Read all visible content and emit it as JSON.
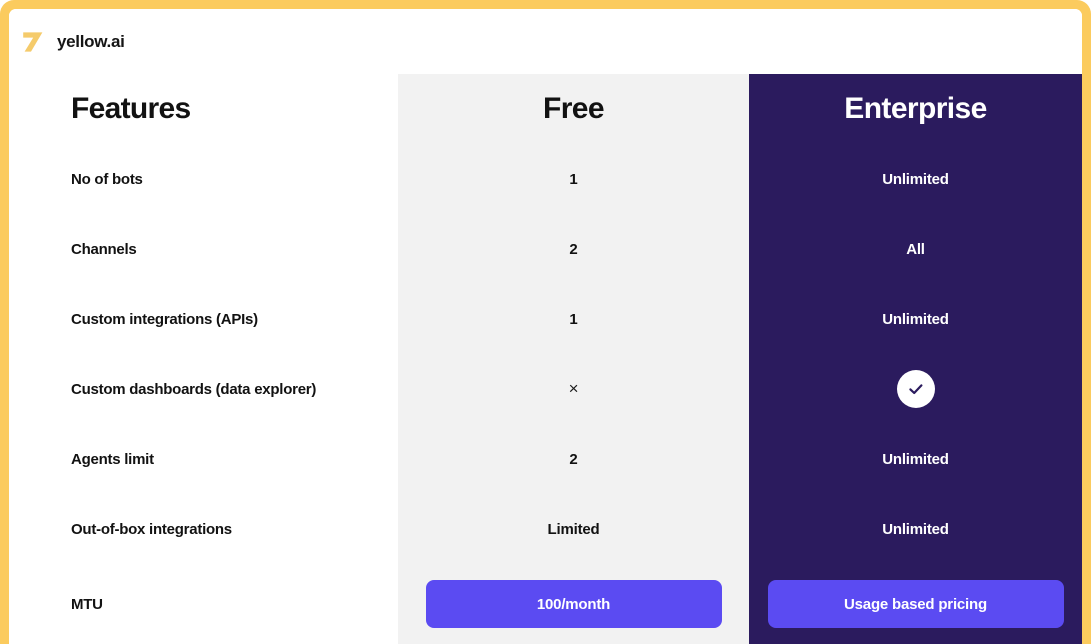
{
  "brand": {
    "name": "yellow.ai",
    "logo_icon": "yellow-ai-logo-icon",
    "logo_color": "#F5CB6B"
  },
  "theme": {
    "frame_border": "#FBCB5E",
    "free_column_bg": "#F2F2F2",
    "enterprise_column_bg": "#2B1B5E",
    "cta_button_bg": "#5B4BF2",
    "text_dark": "#121212",
    "text_light": "#FFFFFF"
  },
  "table": {
    "headers": {
      "features": "Features",
      "free": "Free",
      "enterprise": "Enterprise"
    },
    "rows": [
      {
        "feature": "No of bots",
        "free": "1",
        "free_icon": null,
        "enterprise": "Unlimited",
        "enterprise_icon": null
      },
      {
        "feature": "Channels",
        "free": "2",
        "free_icon": null,
        "enterprise": "All",
        "enterprise_icon": null
      },
      {
        "feature": "Custom integrations (APIs)",
        "free": "1",
        "free_icon": null,
        "enterprise": "Unlimited",
        "enterprise_icon": null
      },
      {
        "feature": "Custom dashboards (data explorer)",
        "free": "×",
        "free_icon": "cross-icon",
        "enterprise": "",
        "enterprise_icon": "check-circle-icon"
      },
      {
        "feature": "Agents limit",
        "free": "2",
        "free_icon": null,
        "enterprise": "Unlimited",
        "enterprise_icon": null
      },
      {
        "feature": "Out-of-box integrations",
        "free": "Limited",
        "free_icon": null,
        "enterprise": "Unlimited",
        "enterprise_icon": null
      },
      {
        "feature": "MTU",
        "free": "",
        "free_icon": null,
        "enterprise": "",
        "enterprise_icon": null
      }
    ]
  },
  "cta": {
    "free_label": "100/month",
    "enterprise_label": "Usage based pricing"
  }
}
